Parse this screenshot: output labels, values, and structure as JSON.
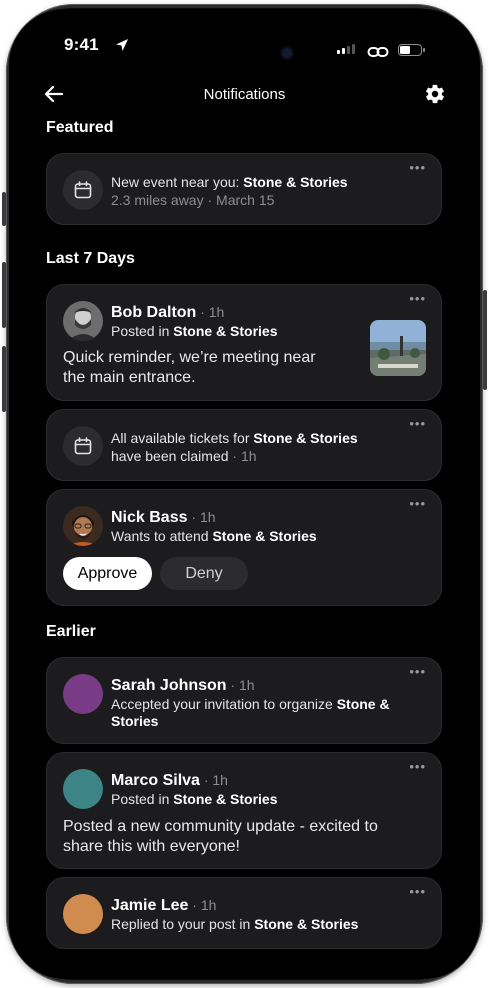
{
  "status_bar": {
    "time": "9:41"
  },
  "header": {
    "title": "Notifications"
  },
  "sections": {
    "featured": "Featured",
    "last7": "Last 7 Days",
    "earlier": "Earlier"
  },
  "featured_card": {
    "prefix": "New event near you: ",
    "event": "Stone & Stories",
    "meta": "2.3 miles away · March 15",
    "more": "•••"
  },
  "bob": {
    "name": "Bob Dalton",
    "time": "· 1h",
    "posted_prefix": "Posted in ",
    "event": "Stone & Stories",
    "body_line1": "Quick reminder, we’re meeting near",
    "body_line2": "the main entrance.",
    "more": "•••"
  },
  "tickets": {
    "line1_prefix": "All available tickets for ",
    "event": "Stone & Stories",
    "line2": "have been claimed",
    "time": "· 1h",
    "more": "•••"
  },
  "nick": {
    "name": "Nick Bass",
    "time": "· 1h",
    "prefix": "Wants to attend ",
    "event": "Stone & Stories",
    "approve": "Approve",
    "deny": "Deny",
    "more": "•••"
  },
  "sarah": {
    "name": "Sarah Johnson",
    "time": "· 1h",
    "prefix": "Accepted your invitation to organize ",
    "event_part1": "Stone &",
    "event_part2": "Stories",
    "avatar_color": "#7a3b86",
    "more": "•••"
  },
  "marco": {
    "name": "Marco Silva",
    "time": "· 1h",
    "posted_prefix": "Posted in ",
    "event": "Stone & Stories",
    "body_line1": "Posted a new community update - excited to",
    "body_line2": "share this with everyone!",
    "avatar_color": "#3d8486",
    "more": "•••"
  },
  "jamie": {
    "name": "Jamie Lee",
    "time": "· 1h",
    "prefix": "Replied to your post in ",
    "event": "Stone & Stories",
    "avatar_color": "#cf8c4e",
    "more": "•••"
  }
}
